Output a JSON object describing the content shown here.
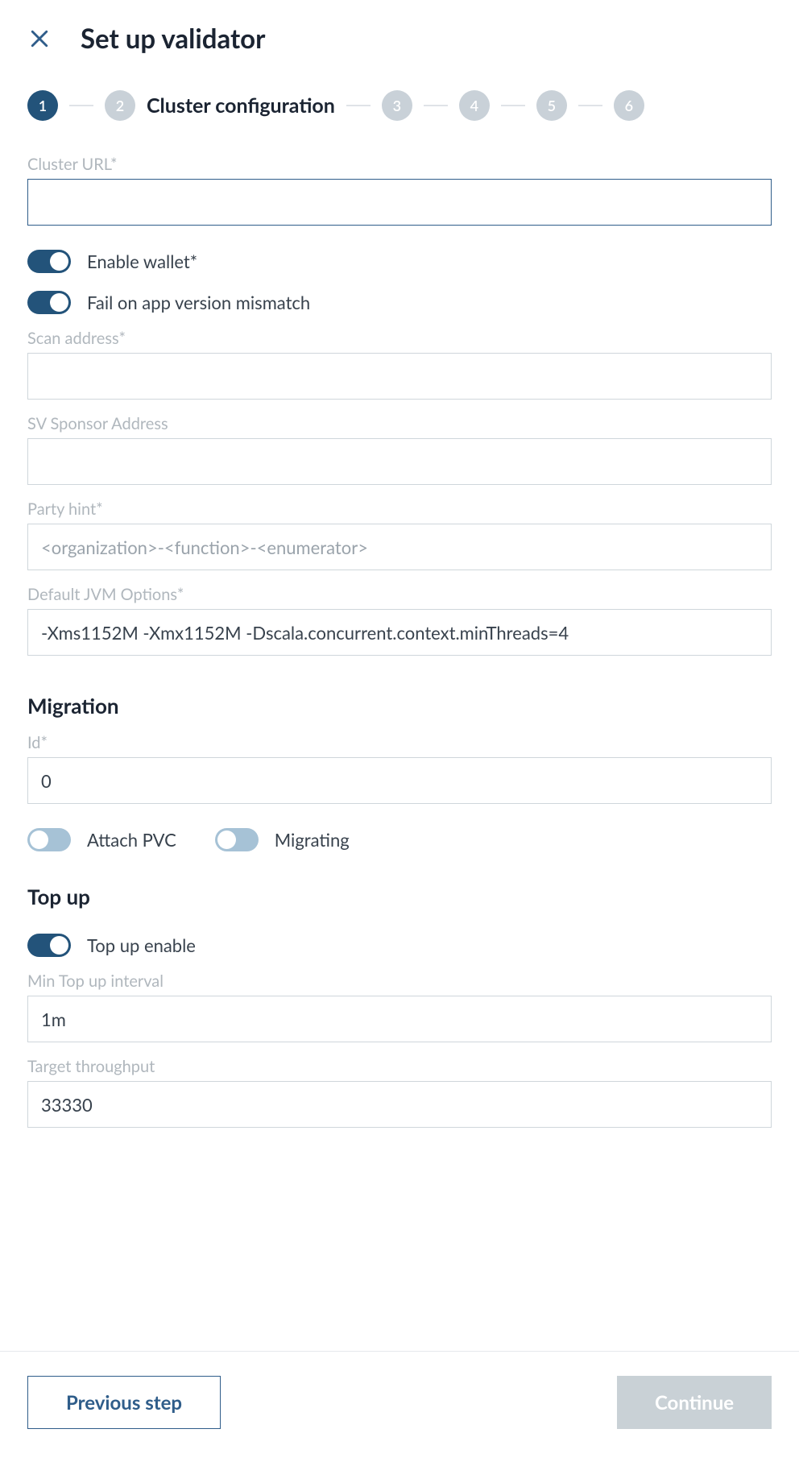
{
  "header": {
    "title": "Set up validator"
  },
  "stepper": {
    "steps": [
      "1",
      "2",
      "3",
      "4",
      "5",
      "6"
    ],
    "current_label": "Cluster configuration",
    "done_index": 0,
    "current_index": 1
  },
  "form": {
    "cluster_url": {
      "label": "Cluster URL*",
      "value": ""
    },
    "enable_wallet": {
      "label": "Enable wallet*",
      "checked": true
    },
    "fail_on_mismatch": {
      "label": "Fail on app version mismatch",
      "checked": true
    },
    "scan_address": {
      "label": "Scan address*",
      "value": ""
    },
    "sv_sponsor": {
      "label": "SV Sponsor Address",
      "value": ""
    },
    "party_hint": {
      "label": "Party hint*",
      "placeholder": "<organization>-<function>-<enumerator>",
      "value": ""
    },
    "jvm_options": {
      "label": "Default JVM Options*",
      "value": "-Xms1152M -Xmx1152M -Dscala.concurrent.context.minThreads=4"
    }
  },
  "migration": {
    "heading": "Migration",
    "id": {
      "label": "Id*",
      "value": "0"
    },
    "attach_pvc": {
      "label": "Attach PVC",
      "checked": false
    },
    "migrating": {
      "label": "Migrating",
      "checked": false
    }
  },
  "topup": {
    "heading": "Top up",
    "enable": {
      "label": "Top up enable",
      "checked": true
    },
    "min_interval": {
      "label": "Min Top up interval",
      "value": "1m"
    },
    "target_throughput": {
      "label": "Target throughput",
      "value": "33330"
    }
  },
  "actions": {
    "previous": "Previous step",
    "continue": "Continue"
  }
}
